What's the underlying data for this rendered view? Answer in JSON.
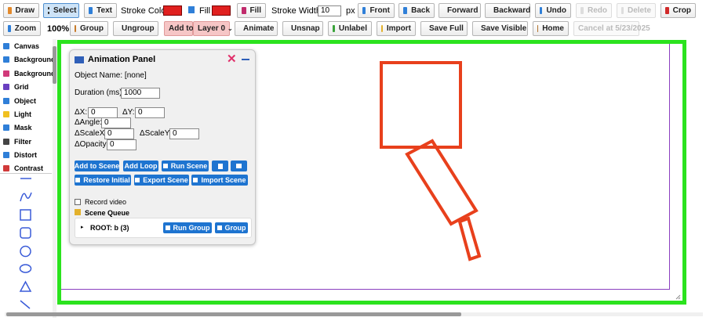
{
  "toolbar1": {
    "draw": "Draw",
    "select": "Select",
    "text": "Text",
    "stroke_color_label": "Stroke Color",
    "fill_label": "Fill",
    "fill_button": "Fill",
    "stroke_width_label": "Stroke Width:",
    "stroke_width_value": "10",
    "px_unit": "px",
    "front": "Front",
    "back": "Back",
    "forward": "Forward",
    "backward": "Backward",
    "undo": "Undo",
    "redo": "Redo",
    "delete": "Delete",
    "crop": "Crop",
    "stroke_color": "#e0201f",
    "fill_color": "#e0201f"
  },
  "toolbar2": {
    "zoom": "Zoom",
    "zoom_level": "100%",
    "group": "Group",
    "ungroup": "Ungroup",
    "add_to": "Add to",
    "layer": "Layer 0",
    "animate": "Animate",
    "unsnap": "Unsnap",
    "unlabel": "Unlabel",
    "import": "Import",
    "save_full": "Save Full",
    "save_visible": "Save Visible",
    "home": "Home",
    "cancel": "Cancel at 5/23/2025"
  },
  "sidebar": {
    "items": [
      "Canvas",
      "Background",
      "Background",
      "Grid",
      "Object",
      "Light",
      "Mask",
      "Filter",
      "Distort",
      "Contrast"
    ]
  },
  "panel": {
    "title": "Animation Panel",
    "object_name_label": "Object Name:",
    "object_name_value": "[none]",
    "duration_label": "Duration (ms):",
    "duration_value": "1000",
    "dx_label": "ΔX:",
    "dx_value": "0",
    "dy_label": "ΔY:",
    "dy_value": "0",
    "dangle_label": "ΔAngle:",
    "dangle_value": "0",
    "dscalex_label": "ΔScaleX:",
    "dscalex_value": "0",
    "dscaley_label": "ΔScaleY:",
    "dscaley_value": "0",
    "dopacity_label": "ΔOpacity:",
    "dopacity_value": "0",
    "add_to_scene": "Add to Scene",
    "add_loop": "Add Loop",
    "run_scene": "Run Scene",
    "restore_initial": "Restore Initial",
    "export_scene": "Export Scene",
    "import_scene": "Import Scene",
    "record_video": "Record video",
    "scene_queue": "Scene Queue",
    "root_label": "ROOT: b (3)",
    "run_group": "Run Group",
    "group": "Group"
  },
  "colors": {
    "canvas_border": "#2be31e",
    "shape_stroke": "#e8401c",
    "panel_button": "#1e74d0"
  }
}
